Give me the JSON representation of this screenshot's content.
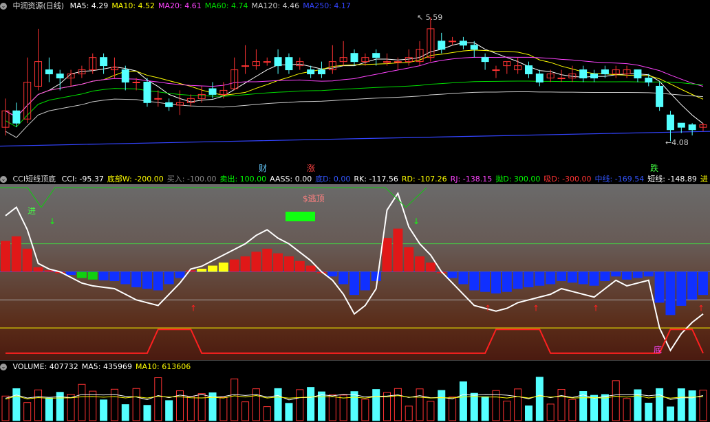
{
  "main": {
    "menu_icon": "chevron-down-icon",
    "title": "中润资源(日线)",
    "ma": [
      {
        "label": "MA5: 4.29",
        "color": "#ffffff"
      },
      {
        "label": "MA10: 4.52",
        "color": "#ffff00"
      },
      {
        "label": "MA20: 4.61",
        "color": "#ff44ff"
      },
      {
        "label": "MA60: 4.74",
        "color": "#00dd00"
      },
      {
        "label": "MA120: 4.46",
        "color": "#cccccc"
      },
      {
        "label": "MA250: 4.17",
        "color": "#3344ff"
      }
    ],
    "high_label": "5.59",
    "low_label": "4.08",
    "events": [
      {
        "label": "财",
        "color": "#66ccff"
      },
      {
        "label": "涨",
        "color": "#ff4444"
      },
      {
        "label": "跌",
        "color": "#44ff44"
      }
    ]
  },
  "cci": {
    "title": "CCI短线顶底",
    "values": [
      {
        "label": "CCI: -95.37",
        "color": "#ffffff"
      },
      {
        "label": "底部W: -200.00",
        "color": "#ffff00"
      },
      {
        "label": "买入: -100.00",
        "color": "#888888"
      },
      {
        "label": "卖出: 100.00",
        "color": "#00ff00"
      },
      {
        "label": "AASS: 0.00",
        "color": "#ffffff"
      },
      {
        "label": "底D: 0.00",
        "color": "#3355ff"
      },
      {
        "label": "RK: -117.56",
        "color": "#ffffff"
      },
      {
        "label": "RD: -107.26",
        "color": "#ffff00"
      },
      {
        "label": "RJ: -138.15",
        "color": "#ff44ff"
      },
      {
        "label": "抛D: 300.00",
        "color": "#00ff00"
      },
      {
        "label": "吸D: -300.00",
        "color": "#ff3333"
      },
      {
        "label": "中线: -169.54",
        "color": "#3355ff"
      },
      {
        "label": "短线: -148.89",
        "color": "#ffffff"
      },
      {
        "label": "进",
        "color": "#ffff00"
      }
    ],
    "escape_label": "$逃顶",
    "enter_label": "进",
    "bottom_label": "底"
  },
  "volume": {
    "values": [
      {
        "label": "VOLUME: 407732",
        "color": "#ffffff"
      },
      {
        "label": "MA5: 435969",
        "color": "#ffffff"
      },
      {
        "label": "MA10: 613606",
        "color": "#ffff00"
      }
    ]
  },
  "chart_data": {
    "type": "candlestick",
    "candles": [
      [
        4.25,
        4.45,
        4.6,
        4.15
      ],
      [
        4.45,
        4.3,
        4.55,
        4.25
      ],
      [
        4.35,
        4.8,
        5.1,
        4.3
      ],
      [
        4.75,
        5.05,
        5.45,
        4.7
      ],
      [
        4.95,
        4.9,
        5.1,
        4.8
      ],
      [
        4.9,
        4.85,
        4.95,
        4.7
      ],
      [
        4.85,
        4.9,
        4.95,
        4.75
      ],
      [
        4.9,
        4.95,
        5.0,
        4.85
      ],
      [
        4.95,
        5.1,
        5.15,
        4.9
      ],
      [
        5.1,
        5.0,
        5.15,
        4.9
      ],
      [
        4.95,
        4.98,
        5.1,
        4.85
      ],
      [
        4.95,
        4.8,
        5.0,
        4.7
      ],
      [
        4.8,
        4.8,
        4.85,
        4.7
      ],
      [
        4.8,
        4.55,
        4.85,
        4.5
      ],
      [
        4.6,
        4.6,
        4.7,
        4.5
      ],
      [
        4.55,
        4.5,
        4.6,
        4.45
      ],
      [
        4.52,
        4.55,
        4.7,
        4.4
      ],
      [
        4.55,
        4.6,
        4.65,
        4.5
      ],
      [
        4.6,
        4.65,
        4.75,
        4.55
      ],
      [
        4.72,
        4.65,
        4.8,
        4.6
      ],
      [
        4.65,
        4.7,
        4.8,
        4.6
      ],
      [
        4.72,
        4.95,
        5.1,
        4.7
      ],
      [
        5.0,
        5.0,
        5.25,
        4.9
      ],
      [
        5.0,
        5.05,
        5.2,
        4.95
      ],
      [
        5.05,
        5.05,
        5.1,
        5.0
      ],
      [
        5.1,
        5.0,
        5.2,
        4.9
      ],
      [
        5.1,
        4.95,
        5.15,
        4.9
      ],
      [
        5.0,
        5.05,
        5.1,
        4.95
      ],
      [
        4.95,
        4.9,
        5.0,
        4.85
      ],
      [
        4.95,
        4.9,
        5.05,
        4.85
      ],
      [
        4.95,
        5.05,
        5.25,
        4.9
      ],
      [
        5.05,
        5.1,
        5.3,
        5.0
      ],
      [
        5.15,
        5.05,
        5.2,
        5.0
      ],
      [
        5.05,
        5.1,
        5.15,
        5.0
      ],
      [
        5.15,
        5.1,
        5.2,
        5.0
      ],
      [
        5.05,
        5.05,
        5.15,
        5.0
      ],
      [
        5.05,
        5.05,
        5.1,
        4.95
      ],
      [
        5.05,
        5.1,
        5.2,
        5.0
      ],
      [
        5.05,
        5.2,
        5.3,
        5.0
      ],
      [
        5.1,
        5.45,
        5.59,
        5.05
      ],
      [
        5.3,
        5.2,
        5.4,
        5.15
      ],
      [
        5.3,
        5.3,
        5.35,
        5.25
      ],
      [
        5.3,
        5.25,
        5.35,
        5.2
      ],
      [
        5.25,
        5.2,
        5.3,
        5.1
      ],
      [
        5.1,
        5.05,
        5.15,
        4.95
      ],
      [
        4.95,
        4.95,
        5.0,
        4.85
      ],
      [
        5.0,
        5.05,
        5.05,
        4.9
      ],
      [
        4.95,
        5.0,
        5.1,
        4.9
      ],
      [
        5.0,
        4.9,
        5.05,
        4.85
      ],
      [
        4.9,
        4.8,
        4.95,
        4.75
      ],
      [
        4.85,
        4.9,
        4.95,
        4.8
      ],
      [
        4.85,
        4.85,
        4.95,
        4.8
      ],
      [
        4.85,
        4.9,
        5.0,
        4.8
      ],
      [
        4.95,
        4.85,
        5.0,
        4.8
      ],
      [
        4.9,
        4.85,
        4.95,
        4.8
      ],
      [
        4.95,
        4.9,
        5.0,
        4.85
      ],
      [
        4.9,
        4.95,
        5.0,
        4.85
      ],
      [
        4.9,
        4.95,
        5.0,
        4.85
      ],
      [
        4.95,
        4.85,
        4.95,
        4.8
      ],
      [
        4.85,
        4.8,
        4.9,
        4.75
      ],
      [
        4.75,
        4.5,
        4.8,
        4.45
      ],
      [
        4.4,
        4.22,
        4.45,
        4.08
      ],
      [
        4.3,
        4.25,
        4.3,
        4.18
      ],
      [
        4.28,
        4.22,
        4.3,
        4.15
      ],
      [
        4.25,
        4.28,
        4.3,
        4.2
      ]
    ]
  }
}
